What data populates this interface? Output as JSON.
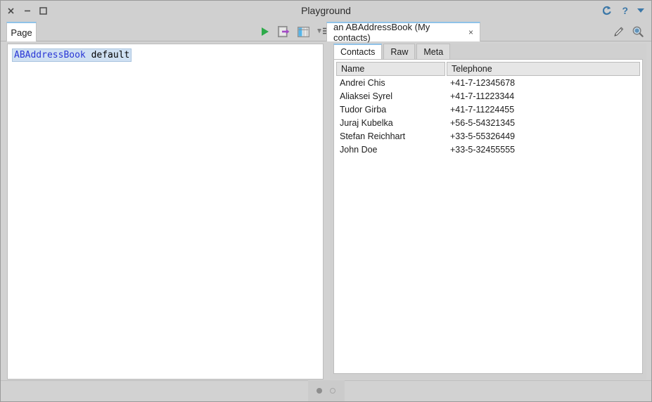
{
  "window": {
    "title": "Playground",
    "controls": [
      {
        "name": "close",
        "glyph": "×"
      },
      {
        "name": "minimize",
        "glyph": "−"
      },
      {
        "name": "maximize",
        "glyph": "□"
      }
    ],
    "title_right": {
      "sync_icon": "sync-icon",
      "help_label": "?",
      "menu_icon": "chevron-down-icon"
    },
    "accent_blue": "#3c78a8"
  },
  "toolbar": {
    "page_tab_label": "Page",
    "object_tab_label": "an ABAddressBook (My contacts)",
    "object_tab_close": "×",
    "icons": [
      {
        "name": "run-icon",
        "title": "Run"
      },
      {
        "name": "publish-icon",
        "title": "Publish"
      },
      {
        "name": "columns-icon",
        "title": "Columns"
      },
      {
        "name": "list-menu-icon",
        "title": "Menu"
      }
    ],
    "right_icons": [
      {
        "name": "pencil-icon",
        "title": "Edit"
      },
      {
        "name": "search-icon",
        "title": "Search"
      }
    ]
  },
  "editor": {
    "code_class": "ABAddressBook",
    "code_separator": " ",
    "code_message": "default"
  },
  "inspector": {
    "tabs": [
      {
        "label": "Contacts",
        "active": true
      },
      {
        "label": "Raw",
        "active": false
      },
      {
        "label": "Meta",
        "active": false
      }
    ],
    "table": {
      "columns": [
        "Name",
        "Telephone"
      ],
      "rows": [
        {
          "name": "Andrei Chis",
          "telephone": "+41-7-12345678"
        },
        {
          "name": "Aliaksei Syrel",
          "telephone": "+41-7-11223344"
        },
        {
          "name": "Tudor Girba",
          "telephone": "+41-7-11224455"
        },
        {
          "name": "Juraj Kubelka",
          "telephone": "+56-5-54321345"
        },
        {
          "name": "Stefan Reichhart",
          "telephone": "+33-5-55326449"
        },
        {
          "name": "John Doe",
          "telephone": "+33-5-32455555"
        }
      ]
    }
  },
  "statusbar": {
    "indicators": [
      {
        "name": "page-indicator-1",
        "state": "filled"
      },
      {
        "name": "page-indicator-2",
        "state": "hollow"
      }
    ]
  }
}
